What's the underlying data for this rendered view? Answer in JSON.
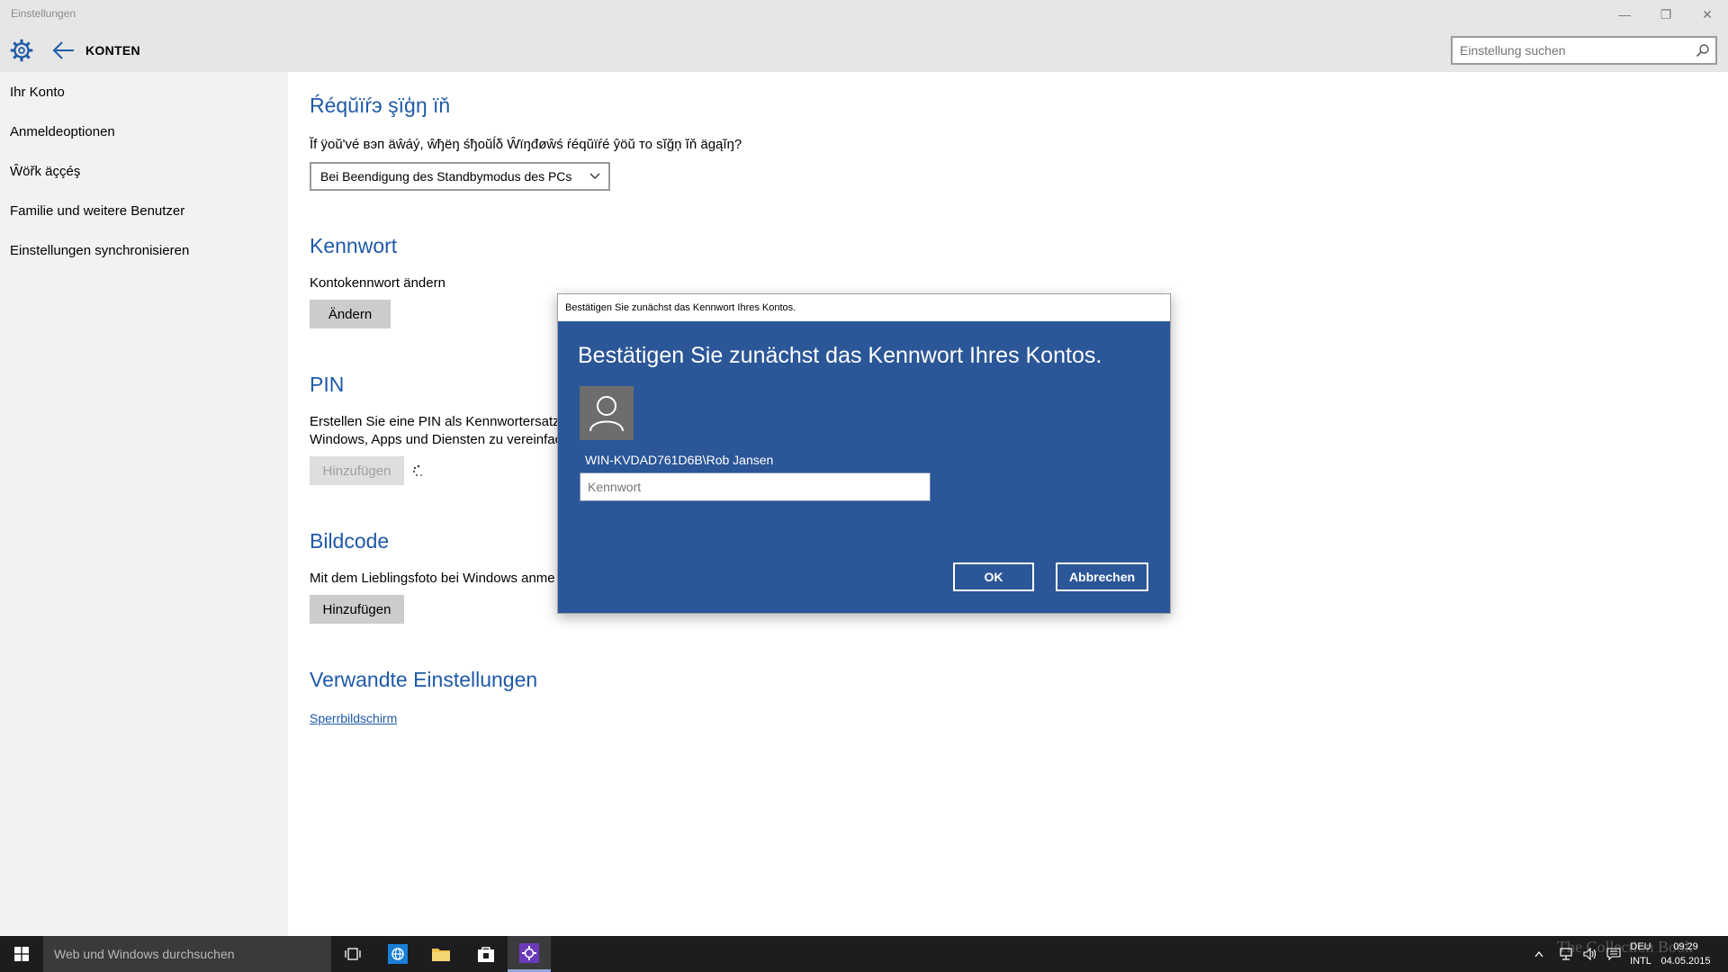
{
  "window": {
    "title": "Einstellungen",
    "controls": {
      "minimize": "—",
      "maximize": "❐",
      "close": "✕"
    }
  },
  "header": {
    "section_title": "KONTEN",
    "search_placeholder": "Einstellung suchen",
    "icons": [
      "gear-icon",
      "back-arrow-icon",
      "search-icon"
    ]
  },
  "sidebar": {
    "items": [
      {
        "label": "Ihr Konto"
      },
      {
        "label": "Anmeldeoptionen"
      },
      {
        "label": "Ŵöřk äççéş"
      },
      {
        "label": "Familie und weitere Benutzer"
      },
      {
        "label": "Einstellungen synchronisieren"
      }
    ]
  },
  "main": {
    "require_signin": {
      "heading": "Ŕéqŭïŕэ şïģŋ ïň",
      "question": "Ĭf ÿoŭ'vé вэᴨ äŵáý, ŵђёŋ śђoŭĺδ Ŵïŋđøŵś ŕéqŭïŕé ŷöŭ то sĭğņ ĭň ägąĭŋ?",
      "dropdown_value": "Bei Beendigung des Standbymodus des PCs"
    },
    "password": {
      "heading": "Kennwort",
      "label": "Kontokennwort ändern",
      "button": "Ändern"
    },
    "pin": {
      "heading": "PIN",
      "line1": "Erstellen Sie eine PIN als Kennwortersatz,",
      "line2": "Windows, Apps und Diensten zu vereinfac",
      "button": "Hinzufügen"
    },
    "picture_password": {
      "heading": "Bildcode",
      "label": "Mit dem Lieblingsfoto bei Windows anme",
      "button": "Hinzufügen"
    },
    "related": {
      "heading": "Verwandte Einstellungen",
      "link": "Sperrbildschirm"
    }
  },
  "dialog": {
    "title": "Bestätigen Sie zunächst das Kennwort Ihres Kontos.",
    "heading": "Bestätigen Sie zunächst das Kennwort Ihres Kontos.",
    "account": "WIN-KVDAD761D6B\\Rob Jansen",
    "password_placeholder": "Kennwort",
    "ok": "OK",
    "cancel": "Abbrechen",
    "accent_color": "#2b5697"
  },
  "taskbar": {
    "search_placeholder": "Web und Windows durchsuchen",
    "language": [
      "DEU",
      "INTL"
    ],
    "time": "09:29",
    "date": "04.05.2015",
    "watermark": "The Collection Book"
  }
}
